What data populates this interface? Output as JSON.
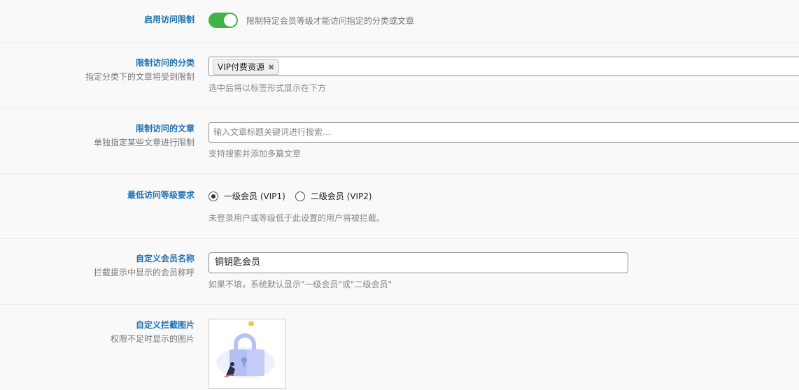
{
  "rows": {
    "access_limit": {
      "title": "启用访问限制",
      "enabled": true,
      "toggle_text": "限制特定会员等级才能访问指定的分类或文章"
    },
    "category": {
      "title": "限制访问的分类",
      "desc": "指定分类下的文章将受到限制",
      "tags": [
        "VIP付费资源"
      ],
      "tag_remove_glyph": "✖",
      "help": "选中后将以标签形式显示在下方"
    },
    "post": {
      "title": "限制访问的文章",
      "desc": "单独指定某些文章进行限制",
      "placeholder": "输入文章标题关键词进行搜索...",
      "help": "支持搜索并添加多篇文章"
    },
    "level": {
      "title": "最低访问等级要求",
      "options": [
        "一级会员 (VIP1)",
        "二级会员 (VIP2)"
      ],
      "selected": "一级会员 (VIP1)",
      "help": "未登录用户或等级低于此设置的用户将被拦截。"
    },
    "member_name": {
      "title": "自定义会员名称",
      "desc": "拦截提示中显示的会员称呼",
      "value": "铜钥匙会员",
      "help": "如果不填，系统默认显示\"一级会员\"或\"二级会员\""
    },
    "block_image": {
      "title": "自定义拦截图片",
      "desc": "权限不足时显示的图片",
      "image": "lock-illustration"
    }
  },
  "colors": {
    "accent": "#2271b1",
    "toggle_on": "#41b449"
  }
}
